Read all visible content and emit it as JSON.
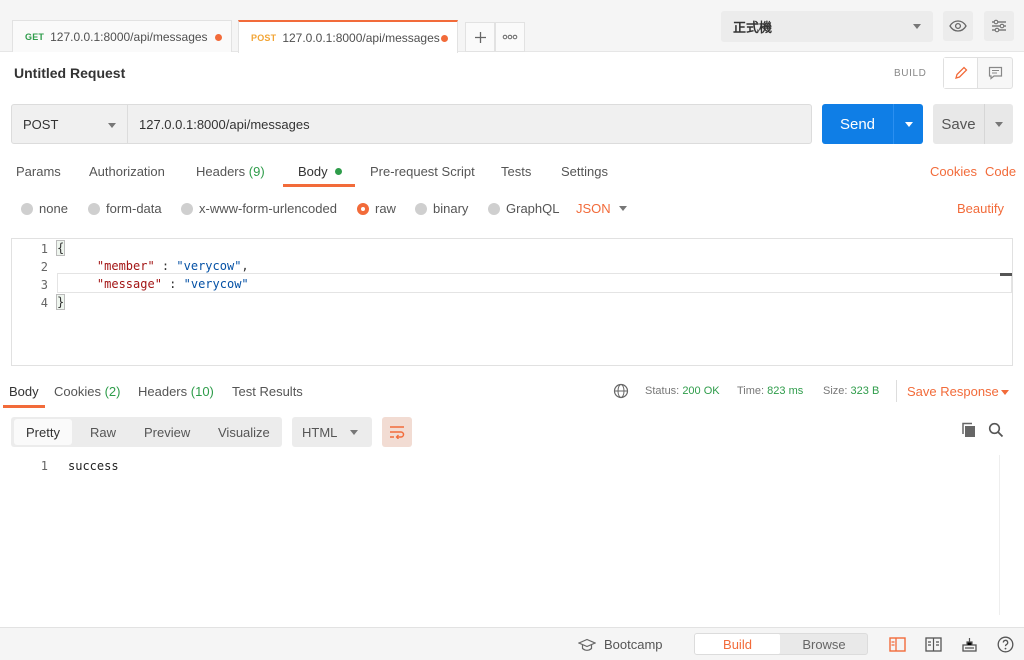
{
  "tabs": [
    {
      "method": "GET",
      "method_color": "#2e9c4a",
      "url": "127.0.0.1:8000/api/messages",
      "unsaved": true
    },
    {
      "method": "POST",
      "method_color": "#f2a536",
      "url": "127.0.0.1:8000/api/messages",
      "unsaved": true
    }
  ],
  "environment": {
    "selected": "正式機"
  },
  "request": {
    "title": "Untitled Request",
    "mode_label": "BUILD",
    "method": "POST",
    "url": "127.0.0.1:8000/api/messages",
    "send_label": "Send",
    "save_label": "Save"
  },
  "request_tabs": {
    "params": "Params",
    "authorization": "Authorization",
    "headers": "Headers",
    "headers_count": "(9)",
    "body": "Body",
    "pre_request": "Pre-request Script",
    "tests": "Tests",
    "settings": "Settings",
    "cookies": "Cookies",
    "code": "Code"
  },
  "body_types": {
    "none": "none",
    "form_data": "form-data",
    "urlencoded": "x-www-form-urlencoded",
    "raw": "raw",
    "binary": "binary",
    "graphql": "GraphQL",
    "raw_format": "JSON",
    "beautify": "Beautify"
  },
  "editor": {
    "line_numbers": [
      "1",
      "2",
      "3",
      "4"
    ],
    "line1": "{",
    "line2_key": "\"member\"",
    "line2_sep": " : ",
    "line2_val": "\"verycow\"",
    "line2_end": ",",
    "line3_key": "\"message\"",
    "line3_sep": " : ",
    "line3_val": "\"verycow\"",
    "line4": "}"
  },
  "response": {
    "tabs": {
      "body": "Body",
      "cookies": "Cookies",
      "cookies_count": "(2)",
      "headers": "Headers",
      "headers_count": "(10)",
      "test_results": "Test Results"
    },
    "status_label": "Status:",
    "status_value": "200 OK",
    "time_label": "Time:",
    "time_value": "823 ms",
    "size_label": "Size:",
    "size_value": "323 B",
    "save_response": "Save Response",
    "views": {
      "pretty": "Pretty",
      "raw": "Raw",
      "preview": "Preview",
      "visualize": "Visualize"
    },
    "format": "HTML",
    "line_number": "1",
    "body_text": "success"
  },
  "statusbar": {
    "bootcamp": "Bootcamp",
    "build": "Build",
    "browse": "Browse"
  },
  "colors": {
    "accent": "#f26b3a",
    "send_blue": "#0f7ee6",
    "success_green": "#2e9c4a"
  }
}
